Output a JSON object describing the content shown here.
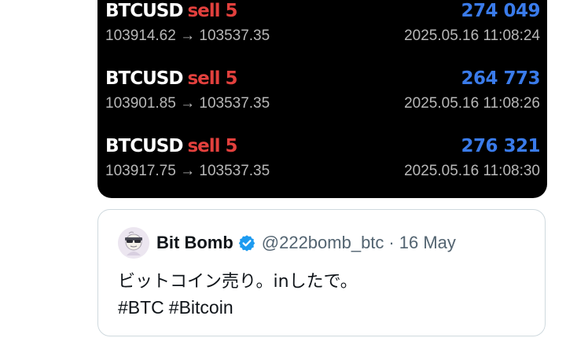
{
  "trades": [
    {
      "symbol": "BTCUSD",
      "side": "sell",
      "qty": "5",
      "amount": "274 049",
      "prices": "103914.62 → 103537.35",
      "timestamp": "2025.05.16 11:08:24"
    },
    {
      "symbol": "BTCUSD",
      "side": "sell",
      "qty": "5",
      "amount": "264 773",
      "prices": "103901.85 → 103537.35",
      "timestamp": "2025.05.16 11:08:26"
    },
    {
      "symbol": "BTCUSD",
      "side": "sell",
      "qty": "5",
      "amount": "276 321",
      "prices": "103917.75 → 103537.35",
      "timestamp": "2025.05.16 11:08:30"
    }
  ],
  "quote": {
    "author_name": "Bit Bomb",
    "handle": "@222bomb_btc",
    "separator": "·",
    "date": "16 May",
    "text": "ビットコイン売り。inしたで。",
    "hashtags": [
      "#BTC",
      "#Bitcoin"
    ],
    "verified_icon": "verified-badge-icon",
    "avatar_icon": "bomb-character-avatar"
  },
  "colors": {
    "card_bg": "#000000",
    "sell": "#e2403d",
    "amount": "#3a7bea",
    "muted": "#b8b8b8",
    "verified": "#1d9bf0"
  }
}
